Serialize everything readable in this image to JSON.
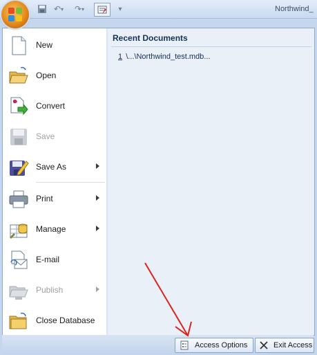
{
  "app": {
    "title_fragment": "Northwind_"
  },
  "menu": {
    "commands": [
      {
        "id": "new",
        "label": "New",
        "enabled": true,
        "submenu": false,
        "icon": "new-document-icon"
      },
      {
        "id": "open",
        "label": "Open",
        "enabled": true,
        "submenu": false,
        "icon": "open-folder-icon"
      },
      {
        "id": "convert",
        "label": "Convert",
        "enabled": true,
        "submenu": false,
        "icon": "convert-icon"
      },
      {
        "id": "save",
        "label": "Save",
        "enabled": false,
        "submenu": false,
        "icon": "save-disk-icon"
      },
      {
        "id": "save-as",
        "label": "Save As",
        "enabled": true,
        "submenu": true,
        "icon": "save-as-icon"
      },
      {
        "id": "print",
        "label": "Print",
        "enabled": true,
        "submenu": true,
        "icon": "printer-icon"
      },
      {
        "id": "manage",
        "label": "Manage",
        "enabled": true,
        "submenu": true,
        "icon": "manage-icon"
      },
      {
        "id": "email",
        "label": "E-mail",
        "enabled": true,
        "submenu": false,
        "icon": "email-icon"
      },
      {
        "id": "publish",
        "label": "Publish",
        "enabled": false,
        "submenu": true,
        "icon": "publish-icon"
      },
      {
        "id": "close-database",
        "label": "Close Database",
        "enabled": true,
        "submenu": false,
        "icon": "close-database-icon"
      }
    ],
    "recent": {
      "header": "Recent Documents",
      "items": [
        {
          "num": "1",
          "path": "\\...\\Northwind_test.mdb..."
        }
      ]
    }
  },
  "footer": {
    "access_options_label": "Access Options",
    "exit_access_label": "Exit Access"
  },
  "colors": {
    "annotation_arrow": "#e0201a",
    "disabled_text": "#a2a2a2",
    "menu_border": "#8fa9cc"
  }
}
